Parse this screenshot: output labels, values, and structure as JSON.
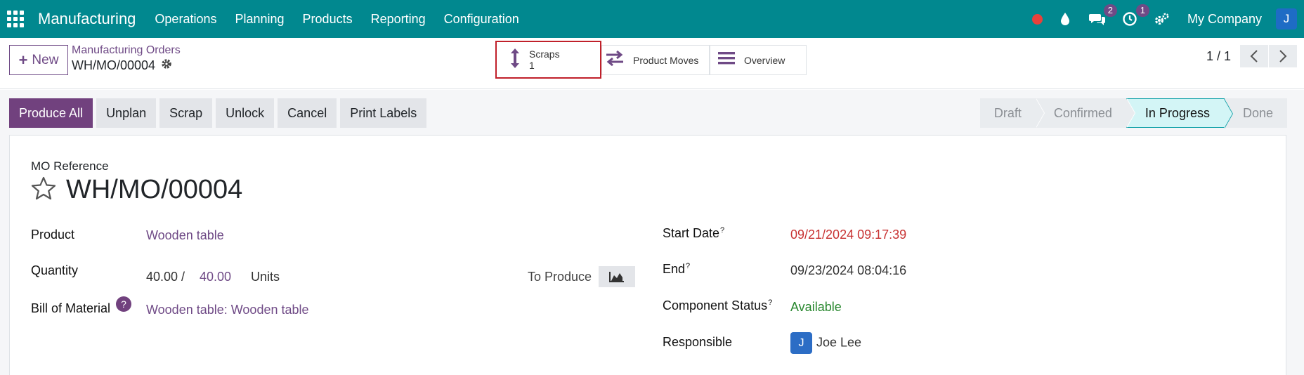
{
  "navbar": {
    "app_title": "Manufacturing",
    "menu": [
      "Operations",
      "Planning",
      "Products",
      "Reporting",
      "Configuration"
    ],
    "messages_badge": "2",
    "activities_badge": "1",
    "company": "My Company",
    "user_initial": "J"
  },
  "control": {
    "new_label": "New",
    "breadcrumb_parent": "Manufacturing Orders",
    "breadcrumb_current": "WH/MO/00004",
    "smart_buttons": {
      "scraps_label": "Scraps",
      "scraps_count": "1",
      "moves_label": "Product Moves",
      "overview_label": "Overview"
    },
    "pager": "1 / 1"
  },
  "actions": {
    "produce_all": "Produce All",
    "unplan": "Unplan",
    "scrap": "Scrap",
    "unlock": "Unlock",
    "cancel": "Cancel",
    "print_labels": "Print Labels"
  },
  "status": [
    "Draft",
    "Confirmed",
    "In Progress",
    "Done"
  ],
  "form": {
    "mo_reference_label": "MO Reference",
    "mo_reference": "WH/MO/00004",
    "product_label": "Product",
    "product": "Wooden table",
    "quantity_label": "Quantity",
    "quantity_done": "40.00 /",
    "quantity_total": "40.00",
    "quantity_uom": "Units",
    "to_produce_label": "To Produce",
    "bom_label": "Bill of Material",
    "bom": "Wooden table: Wooden table",
    "start_date_label": "Start Date",
    "start_date": "09/21/2024 09:17:39",
    "end_label": "End",
    "end": "09/23/2024 08:04:16",
    "component_status_label": "Component Status",
    "component_status": "Available",
    "responsible_label": "Responsible",
    "responsible_initial": "J",
    "responsible": "Joe Lee",
    "help_mark": "?"
  },
  "colors": {
    "navbar": "#01888f",
    "brand_purple": "#71417e",
    "active_stage": "#d3f5f6",
    "late_date": "#c83232",
    "available": "#28872e"
  }
}
